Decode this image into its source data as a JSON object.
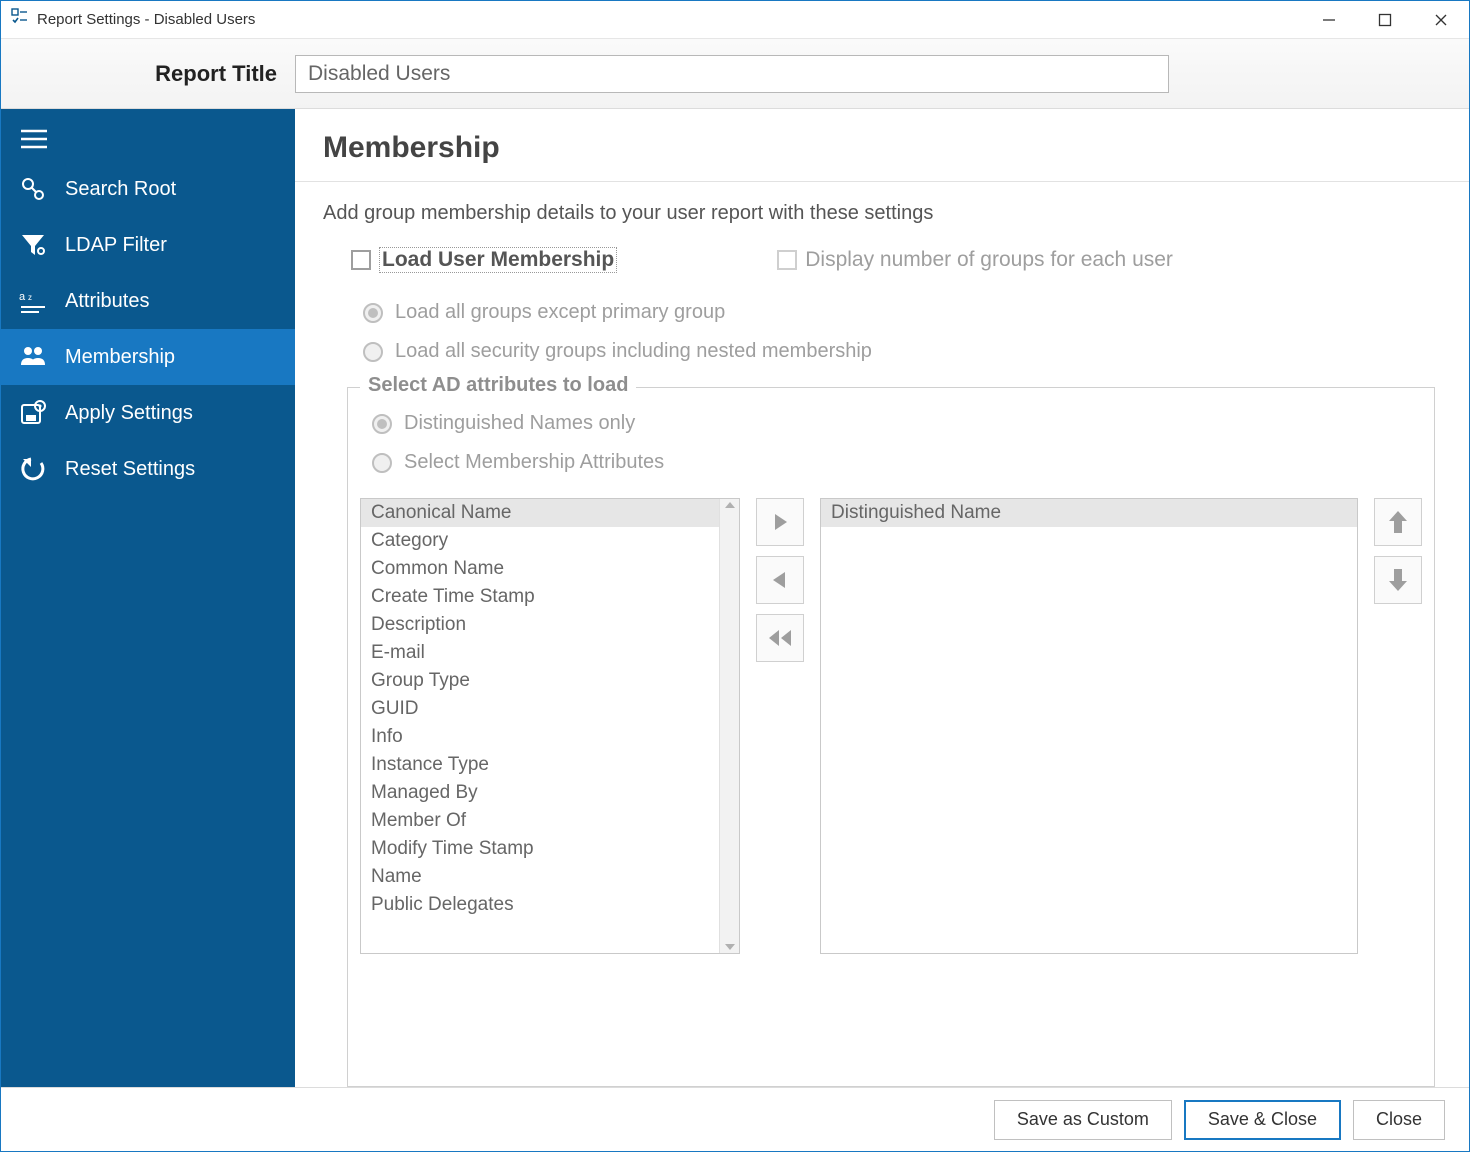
{
  "window": {
    "title": "Report Settings - Disabled Users"
  },
  "header": {
    "report_title_label": "Report Title",
    "report_title_value": "Disabled Users"
  },
  "sidebar": {
    "items": [
      {
        "id": "search-root",
        "label": "Search Root",
        "active": false
      },
      {
        "id": "ldap-filter",
        "label": "LDAP Filter",
        "active": false
      },
      {
        "id": "attributes",
        "label": "Attributes",
        "active": false
      },
      {
        "id": "membership",
        "label": "Membership",
        "active": true
      },
      {
        "id": "apply-settings",
        "label": "Apply Settings",
        "active": false
      },
      {
        "id": "reset-settings",
        "label": "Reset Settings",
        "active": false
      }
    ]
  },
  "content": {
    "title": "Membership",
    "description": "Add group membership details to your user report with these settings",
    "load_user_membership_label": "Load User Membership",
    "display_num_groups_label": "Display number of groups for each user",
    "radio_load_all_groups": "Load all groups except primary group",
    "radio_load_security_groups": "Load all security groups including nested membership",
    "fieldset_legend": "Select AD attributes to load",
    "radio_dn_only": "Distinguished Names only",
    "radio_select_attrs": "Select Membership Attributes",
    "available_attributes": [
      "Canonical Name",
      "Category",
      "Common Name",
      "Create Time Stamp",
      "Description",
      "E-mail",
      "Group Type",
      "GUID",
      "Info",
      "Instance Type",
      "Managed By",
      "Member Of",
      "Modify Time Stamp",
      "Name",
      "Public Delegates"
    ],
    "selected_attributes": [
      "Distinguished Name"
    ]
  },
  "footer": {
    "save_custom": "Save as Custom",
    "save_close": "Save & Close",
    "close": "Close"
  }
}
